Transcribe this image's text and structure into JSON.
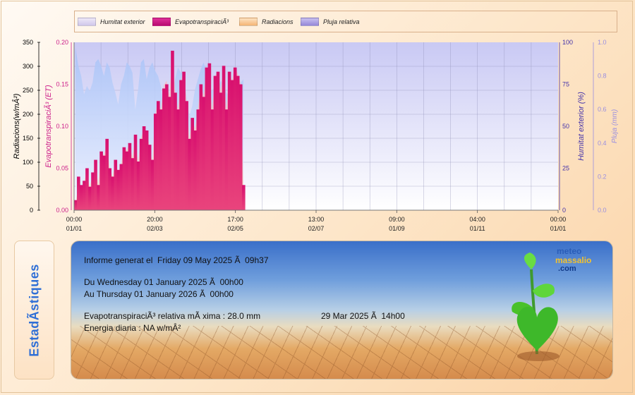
{
  "legend": [
    {
      "label": "Humitat exterior",
      "color": "#d9d4ee"
    },
    {
      "label": "EvapotranspiraciÃ³",
      "color": "#cf0e7e"
    },
    {
      "label": "Radiacions",
      "color": "#f7c38f"
    },
    {
      "label": "Pluja relativa",
      "color": "#a89adf"
    }
  ],
  "axes": {
    "radiation": {
      "label": "Radiacions(w/mÂ²)",
      "ticks": [
        "350",
        "300",
        "250",
        "200",
        "150",
        "100",
        "50",
        "0"
      ],
      "color": "#000000"
    },
    "et": {
      "label": "EvapotranspiraciÃ³ (ET)",
      "ticks": [
        "0.20",
        "0.15",
        "0.10",
        "0.05",
        "0.00"
      ],
      "color": "#cc1f8a"
    },
    "humidity": {
      "label": "Humitat exterior (%)",
      "ticks": [
        "100",
        "75",
        "50",
        "25",
        "0"
      ],
      "color": "#4433aa"
    },
    "rain": {
      "label": "Pluja (mm)",
      "ticks": [
        "1.0",
        "0.8",
        "0.6",
        "0.4",
        "0.2",
        "0.0"
      ],
      "color": "#9a8fe0"
    }
  },
  "x_ticks": [
    {
      "time": "00:00",
      "date": "01/01"
    },
    {
      "time": "20:00",
      "date": "02/03"
    },
    {
      "time": "17:00",
      "date": "02/05"
    },
    {
      "time": "13:00",
      "date": "02/07"
    },
    {
      "time": "09:00",
      "date": "01/09"
    },
    {
      "time": "04:00",
      "date": "01/11"
    },
    {
      "time": "00:00",
      "date": "01/01"
    }
  ],
  "chart_data": {
    "type": "area",
    "x_range": [
      "01/01 00:00",
      "01/01 00:00 (next year)"
    ],
    "data_coverage_end": "02/05 ~19:00",
    "series": [
      {
        "name": "Humitat exterior",
        "unit": "%",
        "axis": "humidity",
        "values": [
          97,
          86,
          80,
          69,
          74,
          71,
          76,
          88,
          90,
          86,
          80,
          88,
          85,
          76,
          70,
          63,
          75,
          80,
          88,
          86,
          82,
          60,
          72,
          88,
          90,
          78,
          85,
          88,
          83,
          80,
          74,
          58,
          52,
          60,
          66,
          78,
          85,
          82,
          79,
          68,
          56,
          62,
          72,
          78,
          84,
          88,
          83,
          73,
          71,
          74,
          72,
          77,
          75,
          70,
          68,
          73,
          75,
          70,
          76,
          78
        ]
      },
      {
        "name": "EvapotranspiraciÃ³",
        "unit": "mm",
        "axis": "et",
        "values": [
          0.012,
          0.04,
          0.03,
          0.035,
          0.05,
          0.028,
          0.045,
          0.06,
          0.03,
          0.07,
          0.065,
          0.085,
          0.05,
          0.04,
          0.06,
          0.048,
          0.055,
          0.075,
          0.07,
          0.08,
          0.062,
          0.09,
          0.058,
          0.085,
          0.1,
          0.095,
          0.078,
          0.06,
          0.115,
          0.13,
          0.12,
          0.145,
          0.15,
          0.135,
          0.19,
          0.14,
          0.12,
          0.155,
          0.165,
          0.13,
          0.085,
          0.11,
          0.095,
          0.12,
          0.15,
          0.135,
          0.17,
          0.175,
          0.12,
          0.16,
          0.165,
          0.14,
          0.172,
          0.12,
          0.165,
          0.155,
          0.17,
          0.16,
          0.15,
          0.03
        ]
      },
      {
        "name": "Radiacions",
        "unit": "w/mÂ²",
        "axis": "radiation",
        "values": [
          15,
          50,
          40,
          60,
          80,
          50,
          70,
          100,
          55,
          120,
          115,
          140,
          90,
          70,
          100,
          80,
          95,
          130,
          125,
          140,
          110,
          150,
          100,
          150,
          170,
          160,
          135,
          100,
          200,
          230,
          210,
          260,
          270,
          240,
          330,
          250,
          210,
          270,
          290,
          230,
          150,
          190,
          170,
          210,
          260,
          240,
          295,
          300,
          210,
          280,
          290,
          250,
          300,
          210,
          290,
          270,
          300,
          285,
          265,
          50
        ]
      }
    ],
    "rain_series": {
      "name": "Pluja relativa",
      "unit": "mm",
      "axis": "rain",
      "values": []
    },
    "grid": true
  },
  "report": {
    "generated": "Informe generat el  Friday 09 May 2025 Ã  09h37",
    "from": "Du Wednesday 01 January 2025 Ã  00h00",
    "to": "Au Thursday 01 January 2026 Ã  00h00",
    "et_max_label": "EvapotranspiraciÃ³ relativa mÃ xima : 28.0 mm",
    "et_max_date": "29 Mar 2025 Ã  14h00",
    "energy": "Energia diaria : NA w/mÂ²"
  },
  "side_title": "EstadÃ­stiques",
  "logo": {
    "line1": "meteo",
    "line2": "massalio",
    "line3": ".com"
  }
}
